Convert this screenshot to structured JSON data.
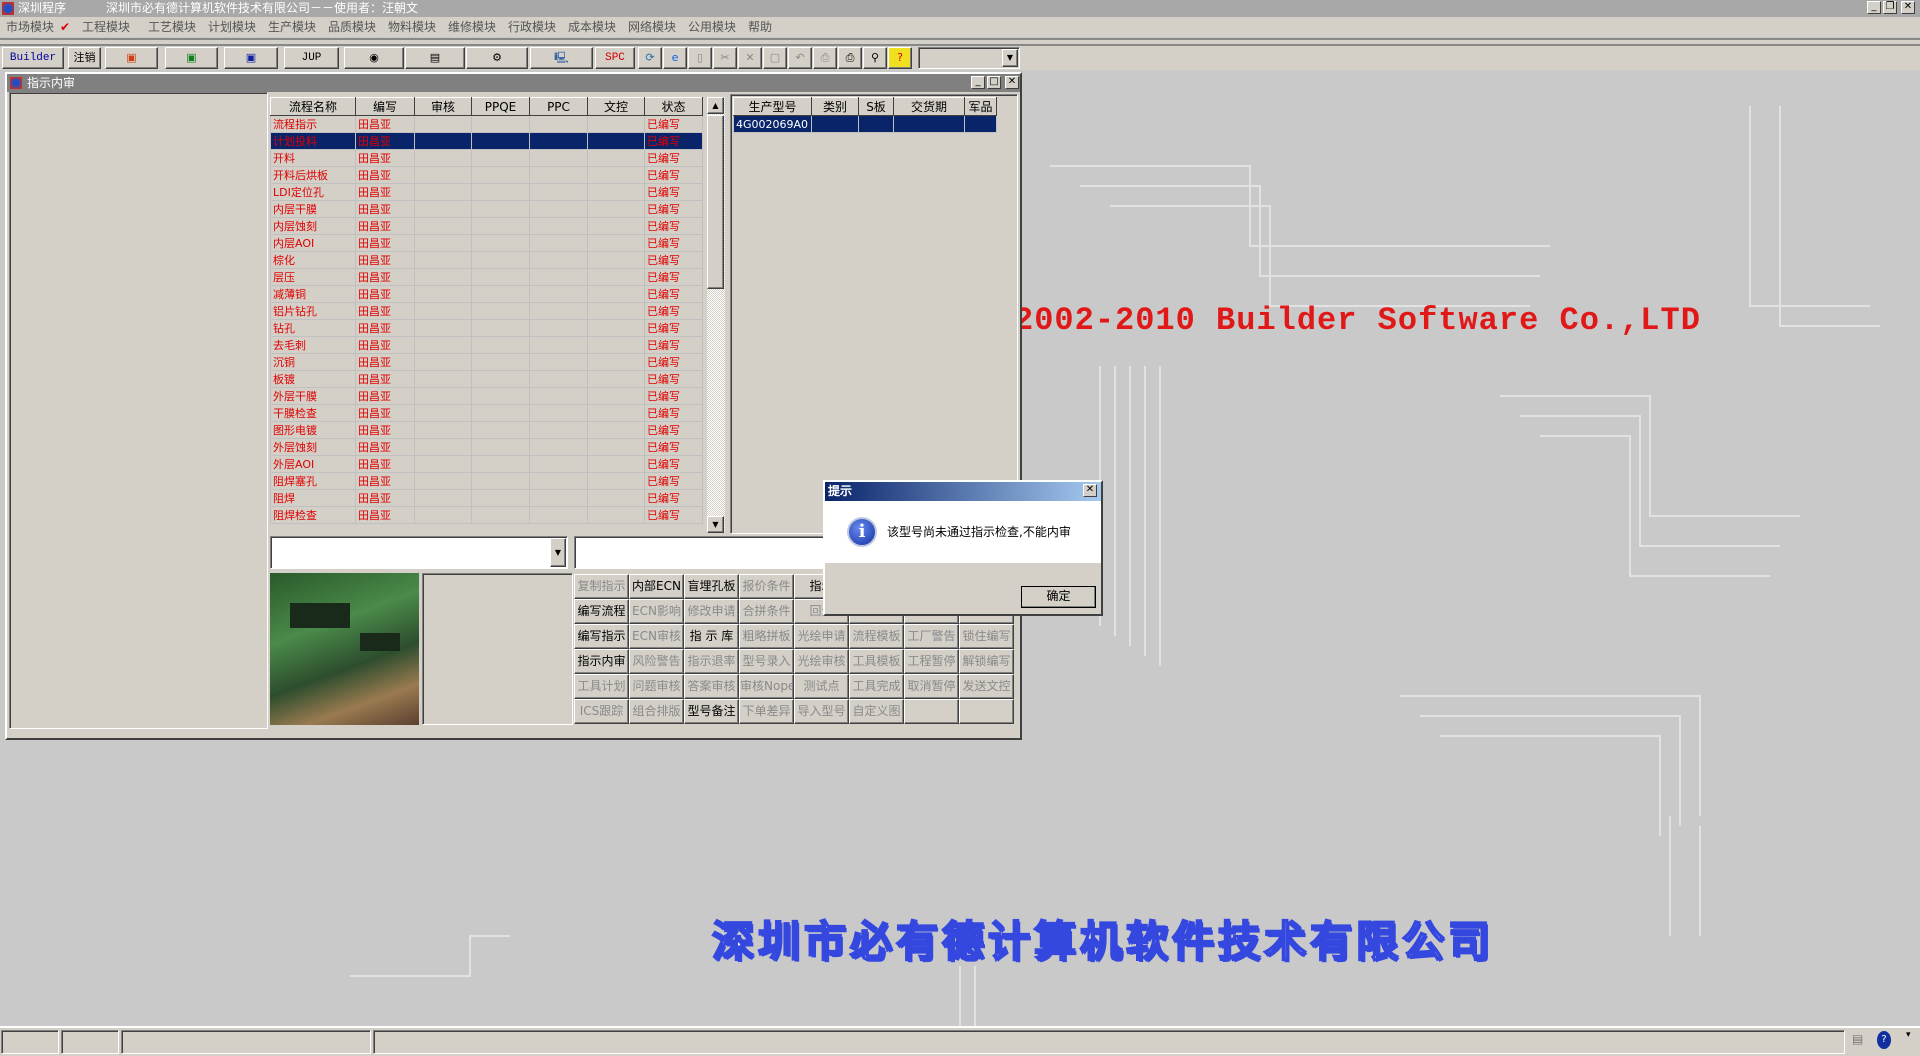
{
  "window": {
    "app_title": "深圳程序",
    "title": "深圳市必有德计算机软件技术有限公司－－使用者：汪朝文"
  },
  "menu": [
    {
      "label": "市场模块"
    },
    {
      "label": "工程模块",
      "checked": true
    },
    {
      "label": "工艺模块"
    },
    {
      "label": "计划模块"
    },
    {
      "label": "生产模块"
    },
    {
      "label": "品质模块"
    },
    {
      "label": "物料模块"
    },
    {
      "label": "维修模块"
    },
    {
      "label": "行政模块"
    },
    {
      "label": "成本模块"
    },
    {
      "label": "网络模块"
    },
    {
      "label": "公用模块"
    },
    {
      "label": "帮助"
    }
  ],
  "toolbar": {
    "builder": "Builder",
    "logout": "注销",
    "jup": "JUP",
    "spc": "SPC",
    "icons": [
      "powerpoint-icon",
      "excel-icon",
      "word-icon",
      "eye-icon",
      "book-icon",
      "network-icon",
      "computer-icon",
      "refresh-icon",
      "ie-icon",
      "new-icon",
      "cut-icon",
      "delete-icon",
      "save-icon",
      "undo-icon",
      "preview-icon",
      "print-icon",
      "find-icon",
      "help-icon"
    ]
  },
  "child": {
    "title": "指示内审"
  },
  "flow_table": {
    "columns": [
      "流程名称",
      "编写",
      "审核",
      "PPQE",
      "PPC",
      "文控",
      "状态"
    ],
    "rows": [
      [
        "流程指示",
        "田昌亚",
        "",
        "",
        "",
        "",
        "已编写"
      ],
      [
        "计划投料",
        "田昌亚",
        "",
        "",
        "",
        "",
        "已编写"
      ],
      [
        "开料",
        "田昌亚",
        "",
        "",
        "",
        "",
        "已编写"
      ],
      [
        "开料后烘板",
        "田昌亚",
        "",
        "",
        "",
        "",
        "已编写"
      ],
      [
        "LDI定位孔",
        "田昌亚",
        "",
        "",
        "",
        "",
        "已编写"
      ],
      [
        "内层干膜",
        "田昌亚",
        "",
        "",
        "",
        "",
        "已编写"
      ],
      [
        "内层蚀刻",
        "田昌亚",
        "",
        "",
        "",
        "",
        "已编写"
      ],
      [
        "内层AOI",
        "田昌亚",
        "",
        "",
        "",
        "",
        "已编写"
      ],
      [
        "棕化",
        "田昌亚",
        "",
        "",
        "",
        "",
        "已编写"
      ],
      [
        "层压",
        "田昌亚",
        "",
        "",
        "",
        "",
        "已编写"
      ],
      [
        "减薄铜",
        "田昌亚",
        "",
        "",
        "",
        "",
        "已编写"
      ],
      [
        "铝片钻孔",
        "田昌亚",
        "",
        "",
        "",
        "",
        "已编写"
      ],
      [
        "钻孔",
        "田昌亚",
        "",
        "",
        "",
        "",
        "已编写"
      ],
      [
        "去毛刺",
        "田昌亚",
        "",
        "",
        "",
        "",
        "已编写"
      ],
      [
        "沉铜",
        "田昌亚",
        "",
        "",
        "",
        "",
        "已编写"
      ],
      [
        "板镀",
        "田昌亚",
        "",
        "",
        "",
        "",
        "已编写"
      ],
      [
        "外层干膜",
        "田昌亚",
        "",
        "",
        "",
        "",
        "已编写"
      ],
      [
        "干膜检查",
        "田昌亚",
        "",
        "",
        "",
        "",
        "已编写"
      ],
      [
        "图形电镀",
        "田昌亚",
        "",
        "",
        "",
        "",
        "已编写"
      ],
      [
        "外层蚀刻",
        "田昌亚",
        "",
        "",
        "",
        "",
        "已编写"
      ],
      [
        "外层AOI",
        "田昌亚",
        "",
        "",
        "",
        "",
        "已编写"
      ],
      [
        "阻焊塞孔",
        "田昌亚",
        "",
        "",
        "",
        "",
        "已编写"
      ],
      [
        "阻焊",
        "田昌亚",
        "",
        "",
        "",
        "",
        "已编写"
      ],
      [
        "阻焊检查",
        "田昌亚",
        "",
        "",
        "",
        "",
        "已编写"
      ]
    ],
    "selected_index": 1
  },
  "model_table": {
    "columns": [
      "生产型号",
      "类别",
      "S板",
      "交货期",
      "军品"
    ],
    "rows": [
      [
        "4G002069A0",
        "",
        "",
        "",
        ""
      ]
    ]
  },
  "buttons": [
    [
      {
        "l": "复制指示",
        "e": false
      },
      {
        "l": "内部ECN",
        "e": true
      },
      {
        "l": "盲埋孔板",
        "e": true
      },
      {
        "l": "报价条件",
        "e": false
      },
      {
        "l": "指示",
        "e": true
      },
      {
        "l": "",
        "e": false
      },
      {
        "l": "",
        "e": false
      },
      {
        "l": "",
        "e": false
      }
    ],
    [
      {
        "l": "编写流程",
        "e": true
      },
      {
        "l": "ECN影响",
        "e": false
      },
      {
        "l": "修改申请",
        "e": false
      },
      {
        "l": "合拼条件",
        "e": false
      },
      {
        "l": "回退",
        "e": false
      },
      {
        "l": "",
        "e": false
      },
      {
        "l": "",
        "e": false
      },
      {
        "l": "",
        "e": false
      }
    ],
    [
      {
        "l": "编写指示",
        "e": true
      },
      {
        "l": "ECN审核",
        "e": false
      },
      {
        "l": "指 示 库",
        "e": true
      },
      {
        "l": "粗略拼板",
        "e": false
      },
      {
        "l": "光绘申请",
        "e": false
      },
      {
        "l": "流程模板",
        "e": false
      },
      {
        "l": "工厂警告",
        "e": false
      },
      {
        "l": "锁住编写",
        "e": false
      }
    ],
    [
      {
        "l": "指示内审",
        "e": true
      },
      {
        "l": "风险警告",
        "e": false
      },
      {
        "l": "指示退率",
        "e": false
      },
      {
        "l": "型号录入",
        "e": false
      },
      {
        "l": "光绘审核",
        "e": false
      },
      {
        "l": "工具模板",
        "e": false
      },
      {
        "l": "工程暂停",
        "e": false
      },
      {
        "l": "解锁编写",
        "e": false
      }
    ],
    [
      {
        "l": "工具计划",
        "e": false
      },
      {
        "l": "问题审核",
        "e": false
      },
      {
        "l": "答案审核",
        "e": false
      },
      {
        "l": "审核Nope",
        "e": false
      },
      {
        "l": "测试点",
        "e": false
      },
      {
        "l": "工具完成",
        "e": false
      },
      {
        "l": "取消暂停",
        "e": false
      },
      {
        "l": "发送文控",
        "e": false
      }
    ],
    [
      {
        "l": "ICS跟踪",
        "e": false
      },
      {
        "l": "组合排版",
        "e": false
      },
      {
        "l": "型号备注",
        "e": true
      },
      {
        "l": "下单差异",
        "e": false
      },
      {
        "l": "导入型号",
        "e": false
      },
      {
        "l": "自定义图",
        "e": false
      },
      {
        "l": "",
        "e": false
      },
      {
        "l": "",
        "e": false
      }
    ]
  ],
  "dialog": {
    "title": "提示",
    "message": "该型号尚未通过指示检查,不能内审",
    "ok": "确定",
    "icon": "info-icon"
  },
  "desktop": {
    "copyright": "2002-2010 Builder Software Co.,LTD",
    "company": "深圳市必有德计算机软件技术有限公司"
  },
  "colors": {
    "selection": "#0a246a",
    "status_text": "#e00000",
    "copyright": "#e01818",
    "company": "#3448e0"
  }
}
